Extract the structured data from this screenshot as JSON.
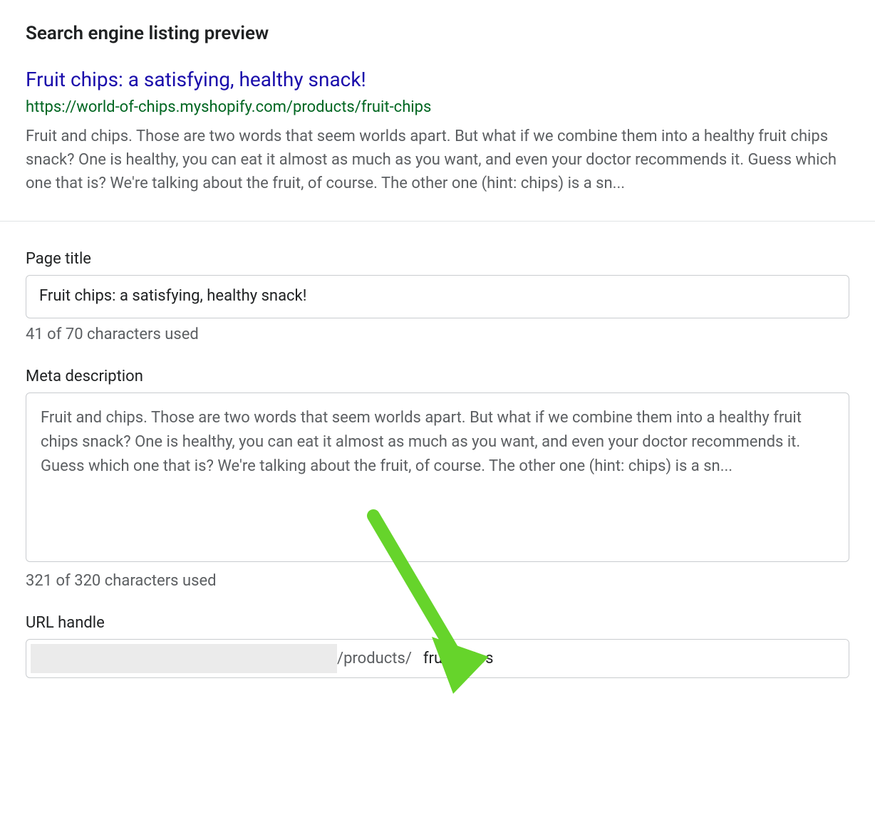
{
  "header": {
    "title": "Search engine listing preview"
  },
  "preview": {
    "title": "Fruit chips: a satisfying, healthy snack!",
    "url": "https://world-of-chips.myshopify.com/products/fruit-chips",
    "description": "Fruit and chips. Those are two words that seem worlds apart. But what if we combine them into a healthy fruit chips snack? One is healthy, you can eat it almost as much as you want, and even your doctor recommends it. Guess which one that is? We're talking about the fruit, of course. The other one (hint: chips) is a sn..."
  },
  "page_title": {
    "label": "Page title",
    "value": "Fruit chips: a satisfying, healthy snack!",
    "counter": "41 of 70 characters used"
  },
  "meta_description": {
    "label": "Meta description",
    "value": "Fruit and chips. Those are two words that seem worlds apart. But what if we combine them into a healthy fruit chips snack? One is healthy, you can eat it almost as much as you want, and even your doctor recommends it. Guess which one that is? We're talking about the fruit, of course. The other one (hint: chips) is a sn...",
    "counter": "321 of 320 characters used"
  },
  "url_handle": {
    "label": "URL handle",
    "products_text": "/products/",
    "value": "fruit-chips"
  },
  "annotation": {
    "arrow_color": "#66d42b"
  }
}
